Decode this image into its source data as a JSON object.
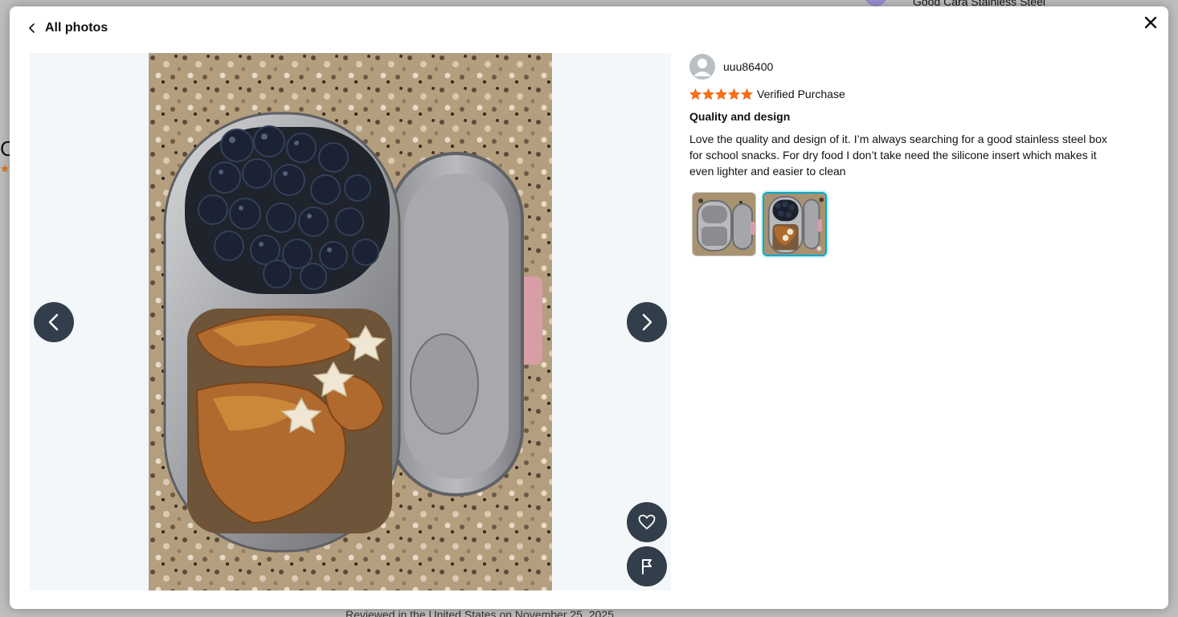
{
  "background": {
    "footer_text": "Reviewed in the United States on November 25, 2025",
    "top_right_text": "Good Cara Stainless Steel"
  },
  "modal": {
    "back_label": "All photos",
    "close_icon": "close-icon"
  },
  "viewer": {
    "photo_alt": "Stainless steel snack box with blueberries and croissant pieces",
    "prev_icon": "chevron-left-icon",
    "next_icon": "chevron-right-icon",
    "like_icon": "heart-icon",
    "flag_icon": "flag-icon"
  },
  "review": {
    "reviewer_name": "uuu86400",
    "rating": 5,
    "verified_label": "Verified Purchase",
    "title": "Quality and design",
    "body": "Love the quality and design of it. I’m always searching for a good stainless steel box for school snacks. For dry food I don’t take need the silicone insert which makes it even lighter and easier to clean",
    "thumbnails": [
      {
        "label": "photo-1",
        "selected": false
      },
      {
        "label": "photo-2",
        "selected": true
      }
    ]
  },
  "colors": {
    "star": "#ff6f0f",
    "nav_button": "#232f3e",
    "thumb_selected_border": "#00a8c8"
  }
}
